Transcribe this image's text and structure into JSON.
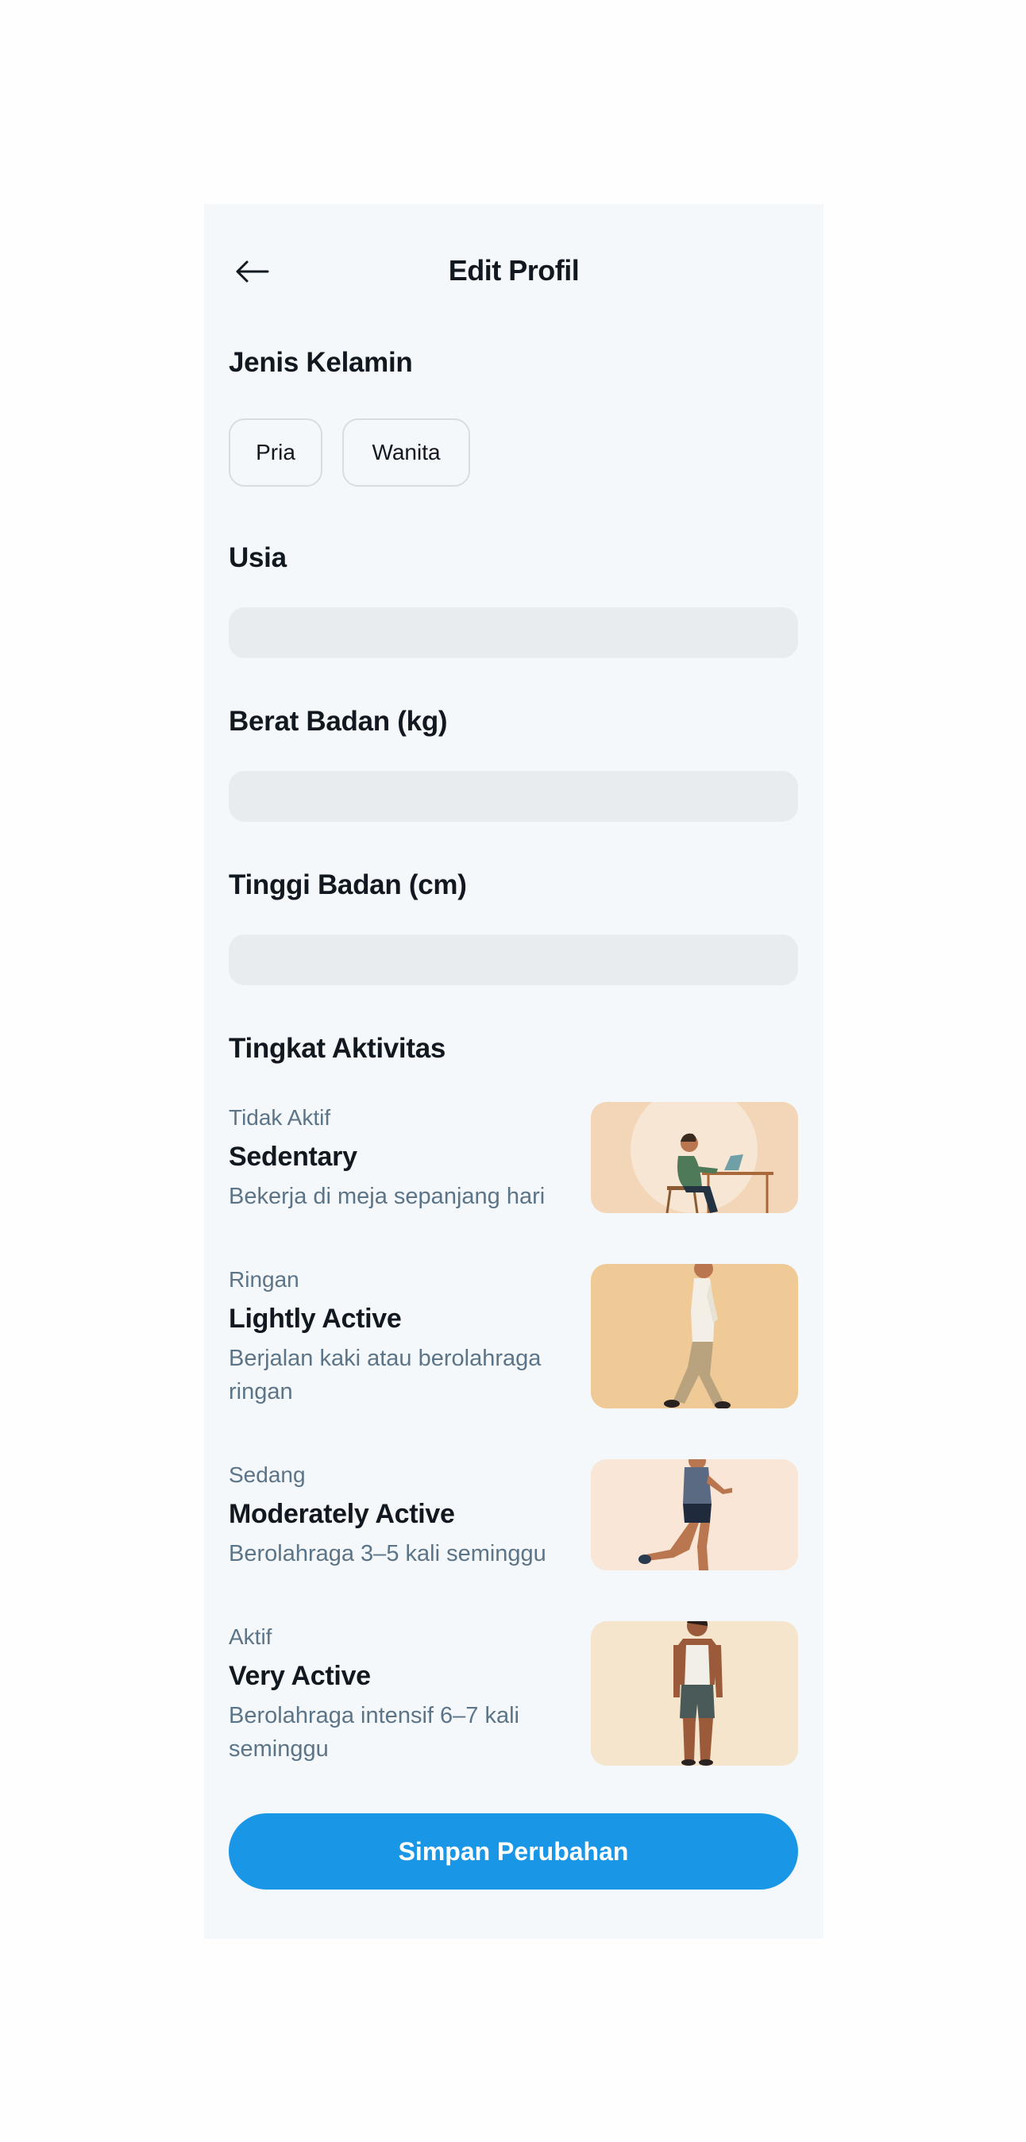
{
  "header": {
    "title": "Edit Profil",
    "back_icon": "arrow-left-icon"
  },
  "gender": {
    "label": "Jenis Kelamin",
    "options": [
      "Pria",
      "Wanita"
    ]
  },
  "age": {
    "label": "Usia",
    "value": ""
  },
  "weight": {
    "label": "Berat Badan (kg)",
    "value": ""
  },
  "height": {
    "label": "Tinggi Badan (cm)",
    "value": ""
  },
  "activity": {
    "label": "Tingkat Aktivitas",
    "items": [
      {
        "level": "Tidak Aktif",
        "name": "Sedentary",
        "desc": "Bekerja di meja sepanjang hari",
        "image": "person-at-desk-illustration"
      },
      {
        "level": "Ringan",
        "name": "Lightly Active",
        "desc": "Berjalan kaki atau berolahraga ringan",
        "image": "person-walking-illustration"
      },
      {
        "level": "Sedang",
        "name": "Moderately Active",
        "desc": "Berolahraga 3–5 kali seminggu",
        "image": "person-running-illustration"
      },
      {
        "level": "Aktif",
        "name": "Very Active",
        "desc": "Berolahraga intensif 6–7 kali seminggu",
        "image": "athlete-standing-illustration"
      }
    ]
  },
  "save_button": {
    "label": "Simpan Perubahan"
  },
  "colors": {
    "primary": "#1a96e6",
    "background": "#f4f8fb",
    "input_fill": "#e8ecef",
    "muted_text": "#5c7488"
  }
}
